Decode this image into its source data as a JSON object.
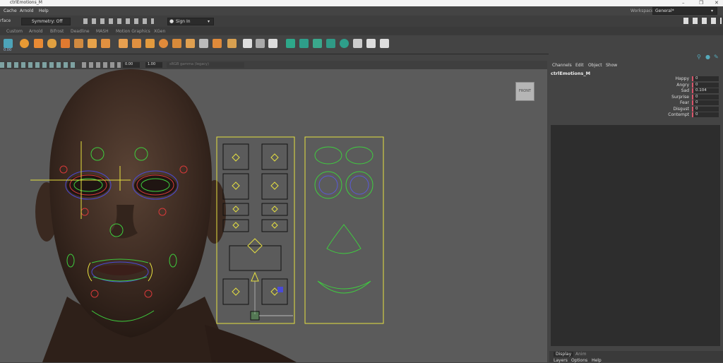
{
  "window": {
    "title": "ctrlEmotions_M"
  },
  "menu": [
    "Cache",
    "Arnold",
    "Help"
  ],
  "workspace": {
    "label": "Workspace:",
    "value": "General*"
  },
  "status": {
    "left_label": "rface",
    "symmetry": "Symmetry: Off",
    "sign_in": "Sign In"
  },
  "shelf_tabs": [
    "Custom",
    "Arnold",
    "Bifrost",
    "Deadline",
    "MASH",
    "Motion Graphics",
    "XGen"
  ],
  "shelf_first_value": "0.00",
  "viewport_toolbar": {
    "field1": "0.00",
    "field2": "1.00",
    "color_space": "sRGB gamma (legacy)"
  },
  "view_cube": "FRONT",
  "channel_box": {
    "menu": [
      "Channels",
      "Edit",
      "Object",
      "Show"
    ],
    "object": "ctrlEmotions_M",
    "channels": [
      {
        "name": "Happy",
        "value": "0"
      },
      {
        "name": "Angry",
        "value": "0"
      },
      {
        "name": "Sad",
        "value": "0.104"
      },
      {
        "name": "Surprise",
        "value": "0"
      },
      {
        "name": "Fear",
        "value": "0"
      },
      {
        "name": "Disgust",
        "value": "0"
      },
      {
        "name": "Contempt",
        "value": "0"
      }
    ]
  },
  "layer_editor": {
    "tabs": [
      "Display",
      "Anim"
    ],
    "menu": [
      "Layers",
      "Options",
      "Help"
    ]
  },
  "colors": {
    "accent": "#d9546a",
    "control_yellow": "#e6e040",
    "control_green": "#3ecf3e"
  }
}
